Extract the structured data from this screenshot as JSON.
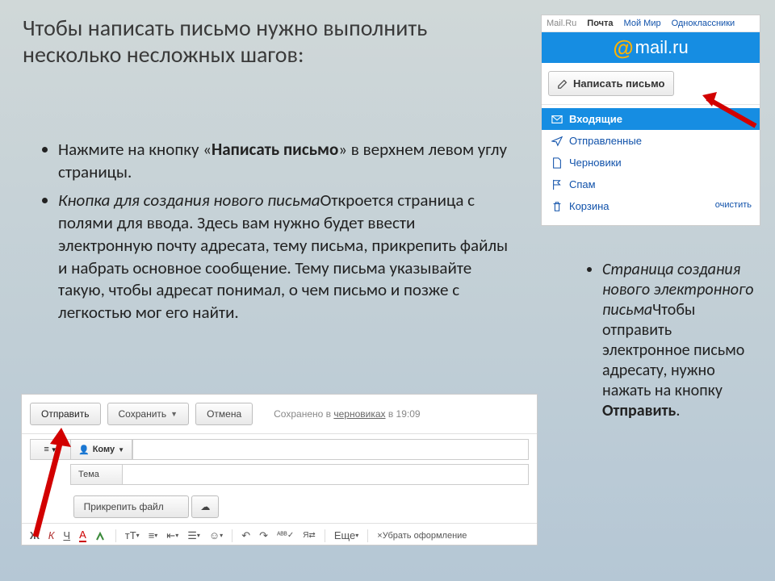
{
  "title": "Чтобы написать письмо нужно выполнить несколько несложных шагов:",
  "bullets": {
    "b1_pre": "Нажмите на кнопку «",
    "b1_bold": "Написать письмо",
    "b1_post": "» в верхнем левом углу страницы.",
    "b2_italic": "Кнопка для создания нового письма",
    "b2_rest": "Откроется страница с полями для ввода. Здесь вам нужно будет ввести электронную почту адресата, тему письма, прикрепить файлы и набрать основное сообщение. Тему письма указывайте такую, чтобы адресат понимал, о чем письмо и позже с легкостью мог его найти."
  },
  "mailru": {
    "nav": [
      "Mail.Ru",
      "Почта",
      "Мой Мир",
      "Одноклассники"
    ],
    "logo_at": "@",
    "logo_text": "mail.ru",
    "compose": "Написать письмо",
    "folders": {
      "inbox": "Входящие",
      "sent": "Отправленные",
      "drafts": "Черновики",
      "spam": "Спам",
      "trash": "Корзина"
    },
    "clear": "очистить"
  },
  "right": {
    "italic": "Страница создания нового электронного письма",
    "rest1": "Чтобы отправить электронное письмо адресату, нужно нажать на кнопку ",
    "bold": "Отправить",
    "rest2": "."
  },
  "compose": {
    "send": "Отправить",
    "save": "Сохранить",
    "cancel": "Отмена",
    "saved_pre": "Сохранено в ",
    "saved_link": "черновиках",
    "saved_post": " в 19:09",
    "to": "Кому",
    "subject": "Тема",
    "attach": "Прикрепить файл",
    "more": "Еще",
    "clear_format": "Убрать оформление",
    "j": "Ж",
    "k": "К",
    "ch": "Ч",
    "a": "А",
    "tt": "тТ"
  }
}
